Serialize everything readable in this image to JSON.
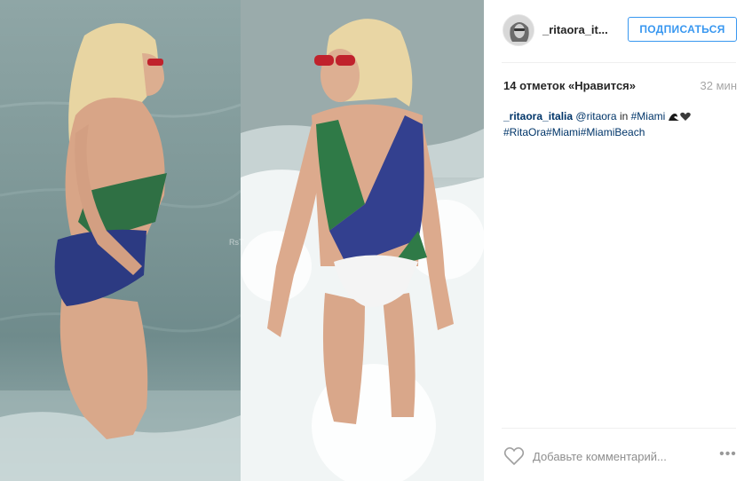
{
  "post": {
    "image_alt": "Two side-by-side beach photos of a woman in a green, blue and white swimsuit",
    "watermark": "RsT"
  },
  "header": {
    "username": "_ritaora_it...",
    "follow_label": "ПОДПИСАТЬСЯ"
  },
  "stats": {
    "likes": "14 отметок «Нравится»",
    "time": "32 мин"
  },
  "caption": {
    "username": "_ritaora_italia",
    "mention": "@ritaora",
    "in_text": "in",
    "location_tag": "#Miami",
    "hashtags": "#RitaOra#Miami#MiamiBeach"
  },
  "footer": {
    "comment_placeholder": "Добавьте комментарий...",
    "more_label": "•••"
  },
  "colors": {
    "accent": "#3897f0",
    "link": "#003569",
    "muted": "#a5a5a5"
  },
  "icons": [
    "heart-icon",
    "more-options-icon",
    "avatar"
  ]
}
